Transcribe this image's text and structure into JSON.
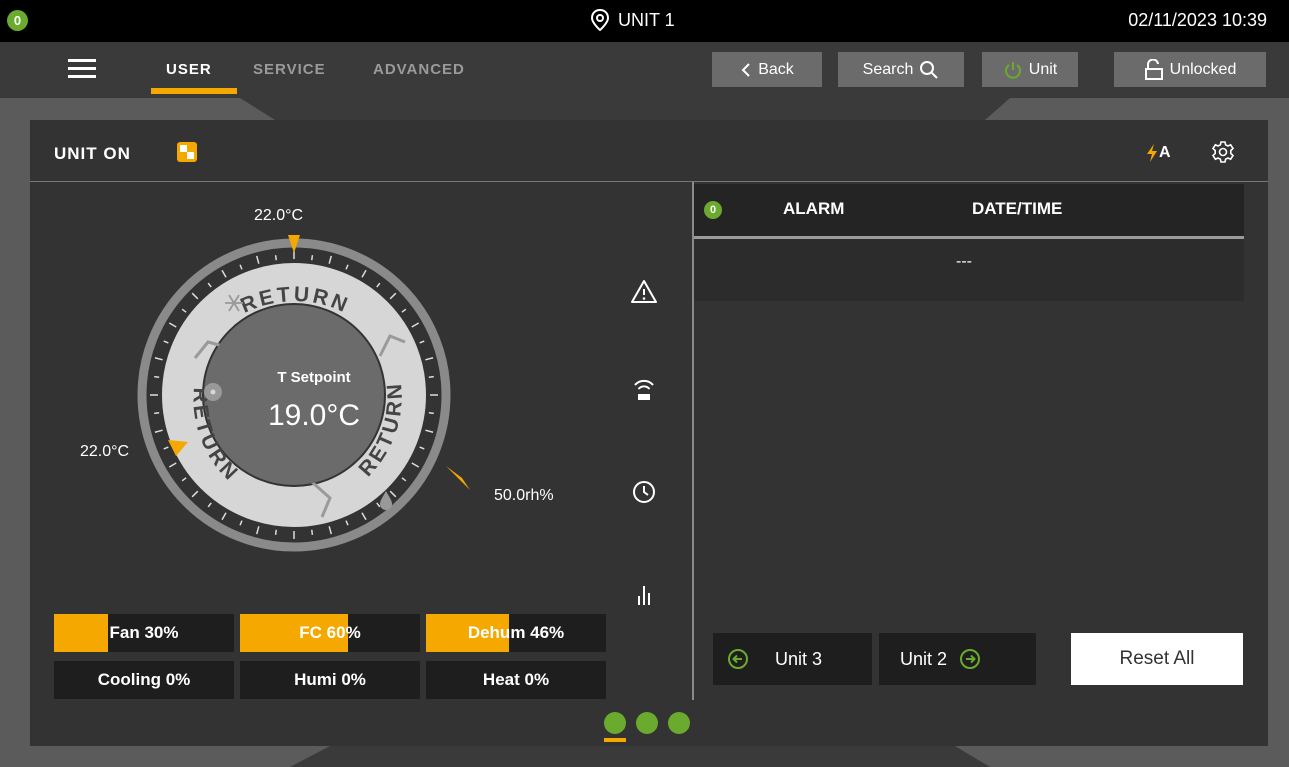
{
  "topbar": {
    "alarm_count": "0",
    "unit_title": "UNIT 1",
    "datetime": "02/11/2023 10:39"
  },
  "nav": {
    "menu_icon": "hamburger-icon",
    "tabs": [
      {
        "label": "USER",
        "active": true
      },
      {
        "label": "SERVICE",
        "active": false
      },
      {
        "label": "ADVANCED",
        "active": false
      }
    ],
    "buttons": {
      "back": "Back",
      "search": "Search",
      "unit": "Unit",
      "lock": "Unlocked"
    }
  },
  "panel": {
    "status": "UNIT ON",
    "auto_label": "A"
  },
  "dial": {
    "top_value": "22.0°C",
    "left_value": "22.0°C",
    "right_value": "50.0rh%",
    "segment_top": "RETURN",
    "segment_left": "RETURN",
    "segment_right": "RETURN",
    "center_label": "T Setpoint",
    "center_value": "19.0°C"
  },
  "bars": [
    {
      "label": "Fan 30%",
      "percent": 30
    },
    {
      "label": "FC 60%",
      "percent": 60
    },
    {
      "label": "Dehum 46%",
      "percent": 46
    },
    {
      "label": "Cooling 0%",
      "percent": 0
    },
    {
      "label": "Humi 0%",
      "percent": 0
    },
    {
      "label": "Heat 0%",
      "percent": 0
    }
  ],
  "alarms": {
    "count": "0",
    "col_alarm": "ALARM",
    "col_datetime": "DATE/TIME",
    "empty_row": "---"
  },
  "pager": {
    "prev_unit": "Unit 3",
    "next_unit": "Unit 2",
    "reset": "Reset All"
  },
  "colors": {
    "accent": "#f5a800",
    "ok_green": "#6aaa2e",
    "panel_bg": "#333333"
  },
  "page_dots": {
    "count": 3,
    "active": 0
  }
}
